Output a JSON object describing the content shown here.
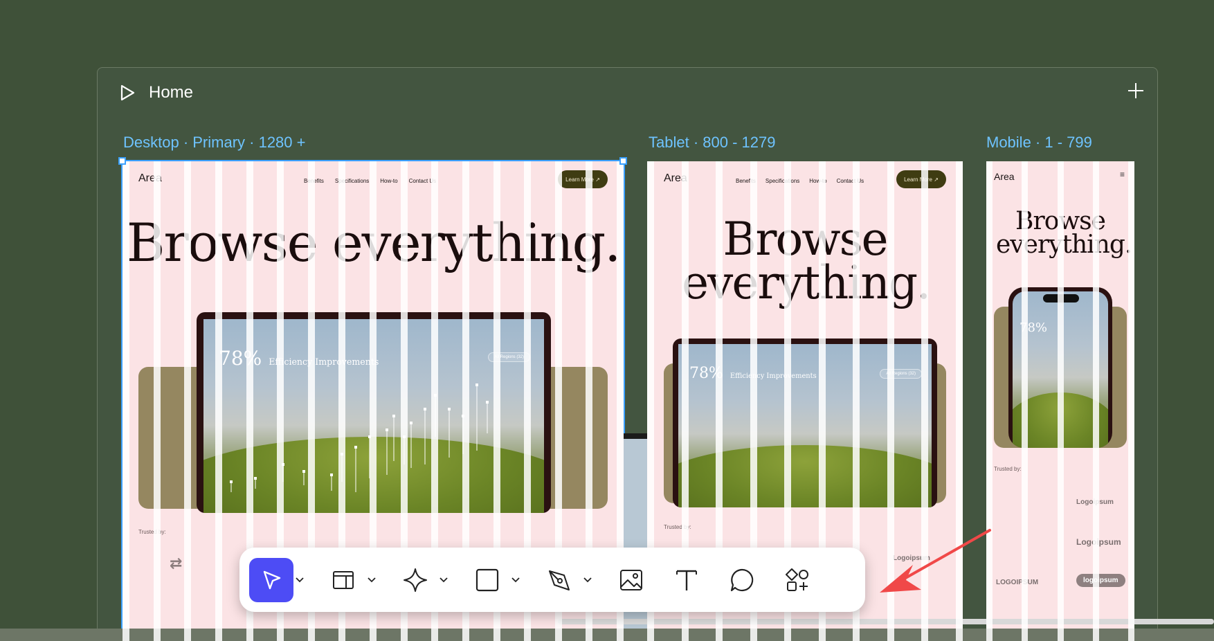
{
  "page": {
    "name": "Home"
  },
  "breakpoints": [
    {
      "label": "Desktop · Primary · 1280 +"
    },
    {
      "label": "Tablet · 800 - 1279"
    },
    {
      "label": "Mobile · 1 - 799"
    }
  ],
  "site": {
    "logo": "Area",
    "nav": [
      "Benefits",
      "Specifications",
      "How-to",
      "Contact Us"
    ],
    "cta": "Learn More ↗",
    "hero_title": "Browse everything.",
    "stat_value": "78%",
    "stat_label": "Efficiency Improvements",
    "filter": "All Regions (32)",
    "trusted": "Trusted by:",
    "logos": [
      "Logoipsum",
      "Logoipsum",
      "LOGOIPSUM",
      "logoipsum"
    ]
  },
  "toolbar": {
    "tools": [
      "select-tool",
      "layout-tool",
      "component-tool",
      "shape-tool",
      "pen-tool",
      "image-tool",
      "text-tool",
      "comment-tool",
      "insert-tool"
    ],
    "active": "select-tool",
    "accent": "#4d4cf5"
  },
  "colors": {
    "canvas": "#3f5139",
    "selection": "#3aa0ff",
    "frame_bg": "#fbe3e5",
    "olive": "#958760",
    "arrow": "#f04848"
  }
}
